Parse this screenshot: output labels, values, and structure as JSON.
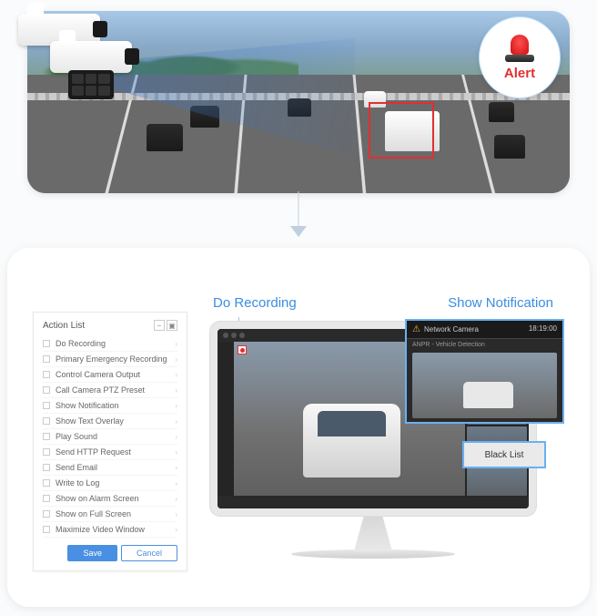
{
  "alert": {
    "label": "Alert"
  },
  "labels": {
    "do_recording": "Do Recording",
    "show_notification": "Show Notification",
    "show_text_overlay": "Show Text Overlay"
  },
  "action_panel": {
    "title": "Action List",
    "items": [
      "Do Recording",
      "Primary Emergency Recording",
      "Control Camera Output",
      "Call Camera PTZ Preset",
      "Show Notification",
      "Show Text Overlay",
      "Play Sound",
      "Send HTTP Request",
      "Send Email",
      "Write to Log",
      "Show on Alarm Screen",
      "Show on Full Screen",
      "Maximize Video Window"
    ],
    "save": "Save",
    "cancel": "Cancel"
  },
  "notification": {
    "title": "Network Camera",
    "time": "18:19:00",
    "subtitle": "ANPR - Vehicle Detection"
  },
  "overlay": {
    "text": "Black List"
  }
}
